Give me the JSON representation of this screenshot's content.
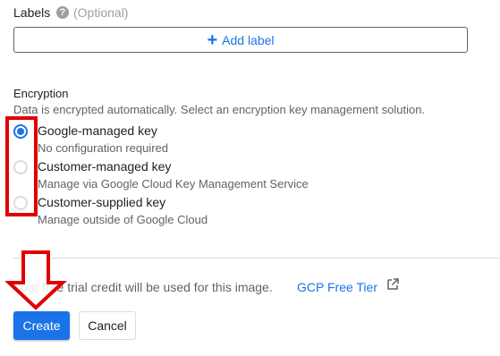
{
  "labels": {
    "title": "Labels",
    "help_icon": "question-mark-icon",
    "help_glyph": "?",
    "optional": "(Optional)",
    "add_button": "Add label",
    "add_glyph": "+"
  },
  "encryption": {
    "title": "Encryption",
    "description": "Data is encrypted automatically. Select an encryption key management solution.",
    "options": [
      {
        "label": "Google-managed key",
        "sub": "No configuration required",
        "checked": true
      },
      {
        "label": "Customer-managed key",
        "sub": "Manage via Google Cloud Key Management Service",
        "checked": false
      },
      {
        "label": "Customer-supplied key",
        "sub": "Manage outside of Google Cloud",
        "checked": false
      }
    ]
  },
  "footer": {
    "trial_text": "Your free trial credit will be used for this image.",
    "link_text": "GCP Free Tier",
    "link_icon": "external-link-icon"
  },
  "actions": {
    "create": "Create",
    "cancel": "Cancel"
  },
  "colors": {
    "accent": "#1a73e8",
    "annotation": "#e00000"
  }
}
